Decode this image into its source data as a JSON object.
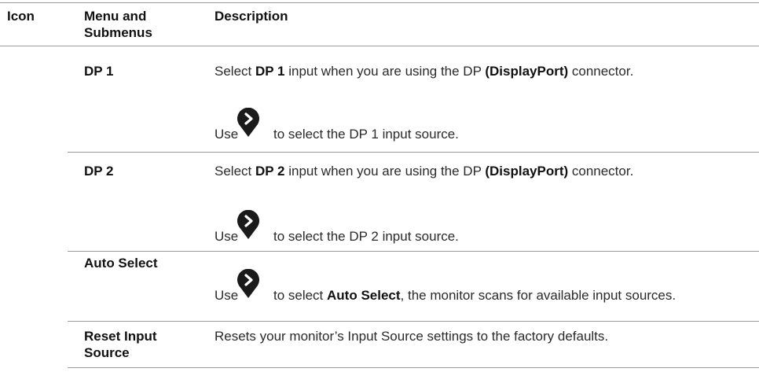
{
  "header": {
    "icon_label": "Icon",
    "menu_label": "Menu and Submenus",
    "desc_label": "Description"
  },
  "rows": [
    {
      "menu": "DP 1",
      "desc_pre": "Select ",
      "desc_bold": "DP 1",
      "desc_mid": " input when you are using the DP ",
      "desc_bold2": "(DisplayPort)",
      "desc_post": " connector.",
      "use_pre": "Use",
      "use_post": "to select the DP 1 input source."
    },
    {
      "menu": "DP 2",
      "desc_pre": "Select ",
      "desc_bold": "DP 2",
      "desc_mid": " input when you are using the DP ",
      "desc_bold2": "(DisplayPort)",
      "desc_post": " connector.",
      "use_pre": "Use",
      "use_post": "to select the DP 2 input source."
    },
    {
      "menu": "Auto Select",
      "use_pre": "Use",
      "use_mid": "to select ",
      "use_bold": "Auto Select",
      "use_post": ", the monitor scans for available input sources."
    },
    {
      "menu": "Reset Input Source",
      "desc": "Resets your monitor’s Input Source settings to the factory defaults."
    }
  ],
  "icons": {
    "select_button": "chevron-right-button-icon",
    "color": "#1a1a1a"
  }
}
